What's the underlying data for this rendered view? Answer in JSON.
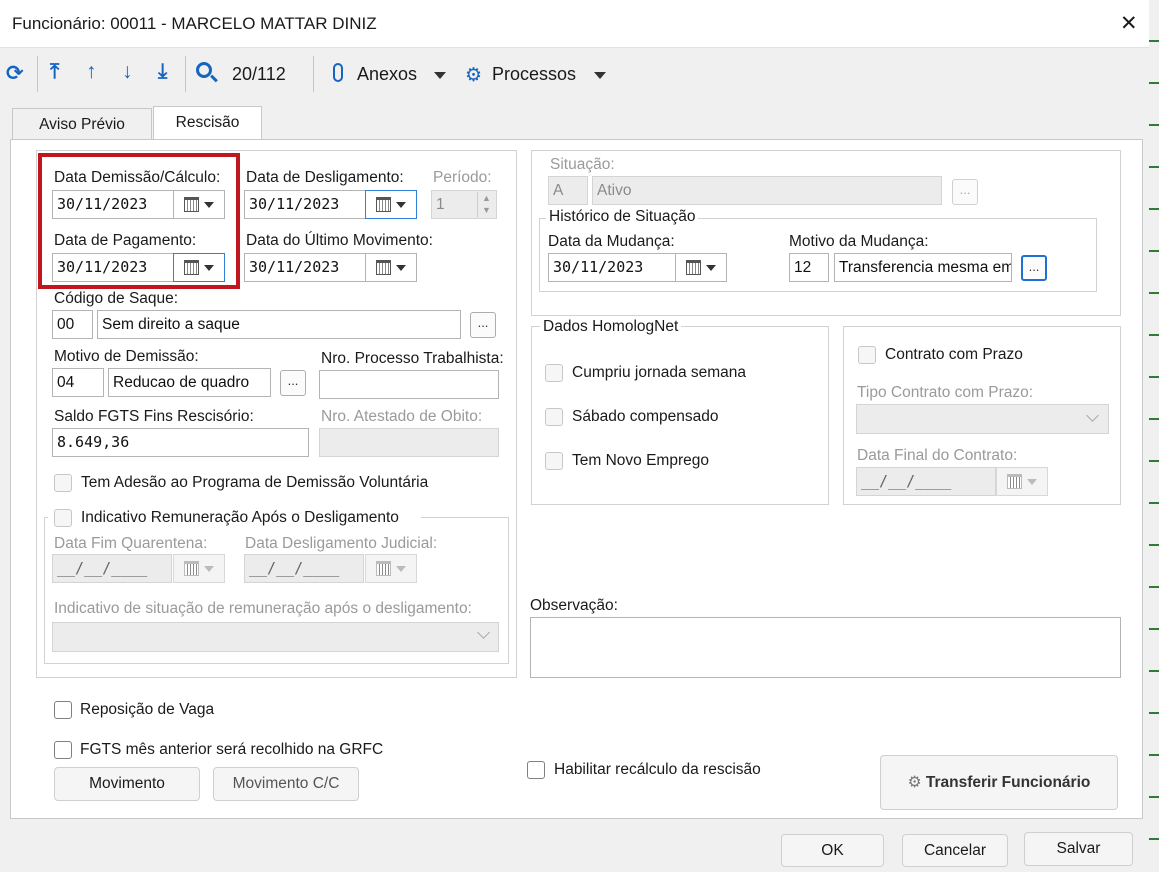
{
  "window": {
    "title": "Funcionário: 00011 - MARCELO MATTAR DINIZ",
    "close": "✕"
  },
  "toolbar": {
    "record_counter": "20/112",
    "anexos": "Anexos",
    "processos": "Processos"
  },
  "tabs": [
    {
      "label": "Aviso Prévio"
    },
    {
      "label": "Rescisão"
    }
  ],
  "left": {
    "data_demissao": {
      "label": "Data Demissão/Cálculo:",
      "value": "30/11/2023"
    },
    "data_desligamento": {
      "label": "Data de Desligamento:",
      "value": "30/11/2023"
    },
    "periodo": {
      "label": "Período:",
      "value": "1"
    },
    "data_pagamento": {
      "label": "Data de Pagamento:",
      "value": "30/11/2023"
    },
    "data_ultimo_movimento": {
      "label": "Data do Último Movimento:",
      "value": "30/11/2023"
    },
    "codigo_saque": {
      "label": "Código de Saque:",
      "code": "00",
      "desc": "Sem direito a saque"
    },
    "motivo_demissao": {
      "label": "Motivo de Demissão:",
      "code": "04",
      "desc": "Reducao de quadro"
    },
    "nro_processo": {
      "label": "Nro. Processo Trabalhista:",
      "value": ""
    },
    "saldo_fgts": {
      "label": "Saldo FGTS Fins Rescisório:",
      "value": "8.649,36"
    },
    "nro_atestado": {
      "label": "Nro. Atestado de Obito:",
      "value": ""
    },
    "pdv": {
      "label": "Tem Adesão ao Programa de Demissão Voluntária"
    },
    "indicativo_group": {
      "label": "Indicativo Remuneração Após o Desligamento"
    },
    "data_fim_quarentena": {
      "label": "Data Fim Quarentena:",
      "value": "__/__/____"
    },
    "data_deslig_judicial": {
      "label": "Data Desligamento Judicial:",
      "value": "__/__/____"
    },
    "indicativo_situacao": {
      "label": "Indicativo de situação de remuneração após o desligamento:",
      "value": ""
    }
  },
  "right": {
    "situacao": {
      "label": "Situação:",
      "code": "A",
      "desc": "Ativo"
    },
    "historico": {
      "label": "Histórico de Situação",
      "data_label": "Data da Mudança:",
      "data_value": "30/11/2023",
      "motivo_label": "Motivo da Mudança:",
      "motivo_code": "12",
      "motivo_desc": "Transferencia mesma em"
    },
    "homolognet": {
      "label": "Dados HomologNet",
      "cumpriu": "Cumpriu jornada semana",
      "sabado": "Sábado compensado",
      "novo_emprego": "Tem Novo Emprego"
    },
    "contrato": {
      "label": "Contrato com Prazo",
      "tipo_label": "Tipo Contrato com Prazo:",
      "tipo_value": "",
      "data_final_label": "Data Final do Contrato:",
      "data_final_value": "__/__/____"
    },
    "observacao": {
      "label": "Observação:",
      "value": ""
    }
  },
  "bottom": {
    "reposicao": "Reposição de Vaga",
    "fgts_anterior": "FGTS mês anterior será recolhido na GRFC",
    "habilitar_recalculo": "Habilitar recálculo da rescisão",
    "movimento": "Movimento",
    "movimento_cc": "Movimento C/C",
    "transferir": "Transferir Funcionário"
  },
  "footer": {
    "ok": "OK",
    "cancelar": "Cancelar",
    "salvar": "Salvar"
  },
  "colors": {
    "accent": "#1565c0",
    "highlight_box": "#c0171e"
  }
}
